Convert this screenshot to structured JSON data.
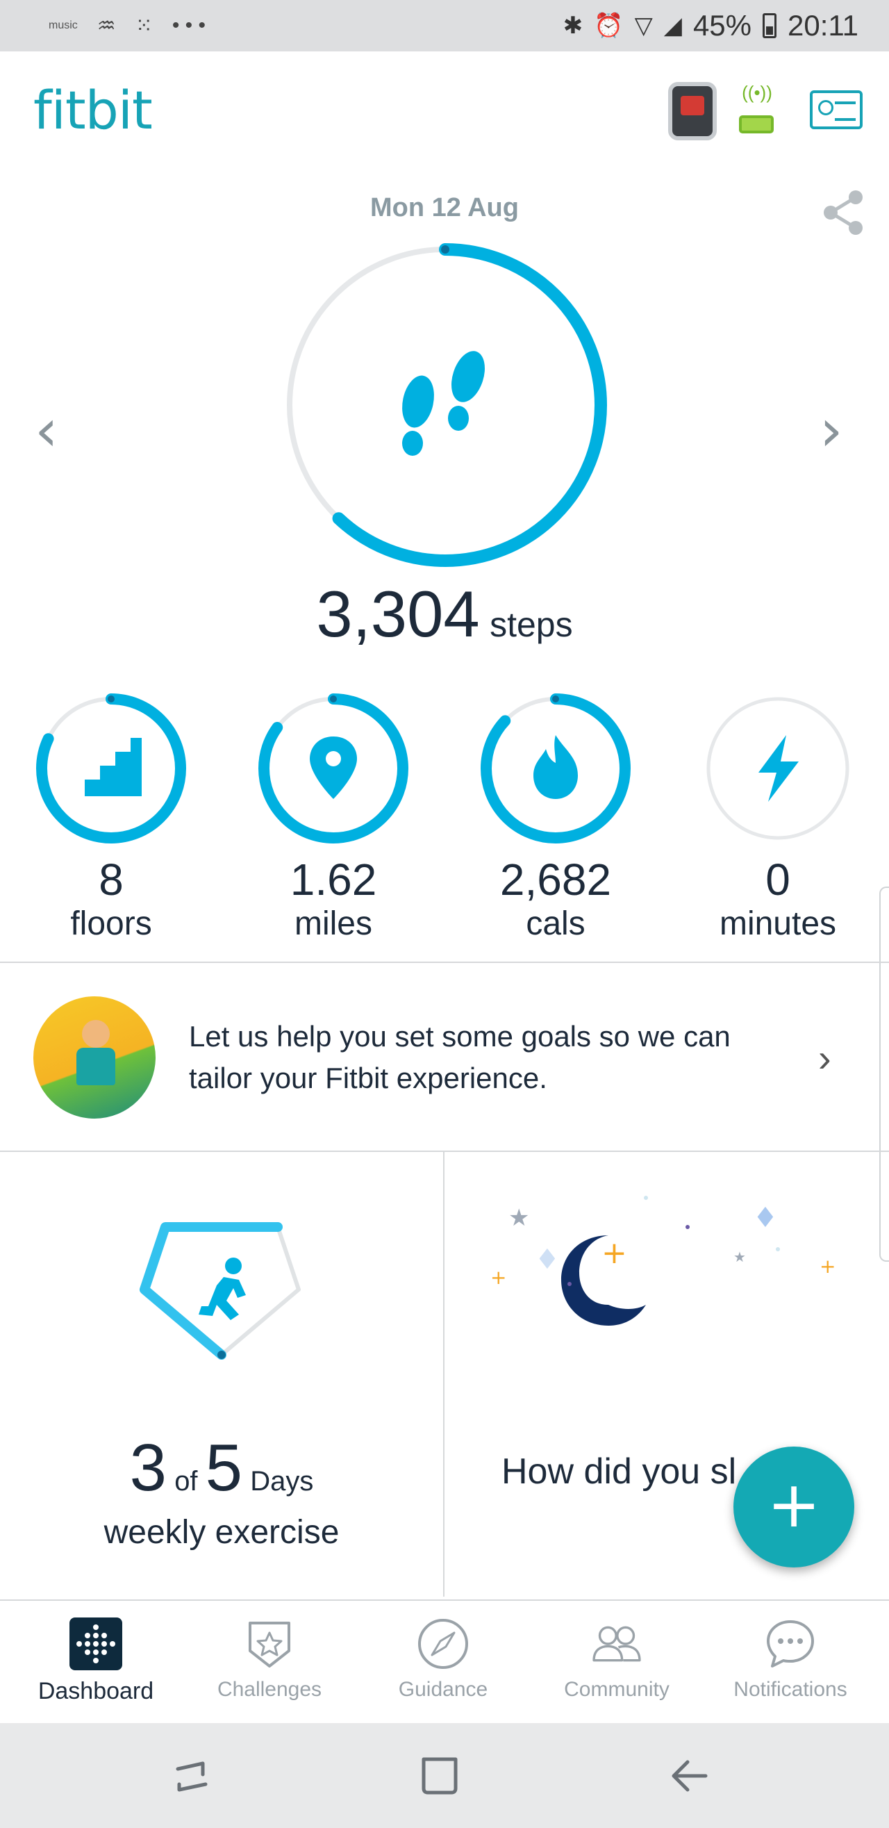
{
  "status_bar": {
    "left_icons": [
      "music",
      "amazon-icon",
      "fitbit-dots-icon",
      "more-icon"
    ],
    "music_label": "music",
    "more": "• • •",
    "battery": "45%",
    "time": "20:11"
  },
  "header": {
    "logo": "fitbit"
  },
  "dashboard": {
    "date": "Mon 12 Aug",
    "steps": {
      "value": "3,304",
      "unit": "steps",
      "progress": 0.62
    },
    "stats": [
      {
        "value": "8",
        "unit": "floors",
        "icon": "stairs-icon",
        "progress": 0.82
      },
      {
        "value": "1.62",
        "unit": "miles",
        "icon": "location-pin-icon",
        "progress": 0.85
      },
      {
        "value": "2,682",
        "unit": "cals",
        "icon": "flame-icon",
        "progress": 0.87
      },
      {
        "value": "0",
        "unit": "minutes",
        "icon": "lightning-icon",
        "progress": 0
      }
    ]
  },
  "goal_banner": {
    "text": "Let us help you set some goals so we can tailor your Fitbit experience."
  },
  "tiles": {
    "exercise": {
      "count": "3",
      "of": "of",
      "total": "5",
      "days": "Days",
      "label": "weekly exercise",
      "progress": 0.6
    },
    "sleep": {
      "prompt": "How did you sl"
    }
  },
  "fab": {
    "label": "+"
  },
  "bottom_nav": [
    {
      "label": "Dashboard",
      "icon": "dashboard-icon",
      "active": true
    },
    {
      "label": "Challenges",
      "icon": "challenges-icon",
      "active": false
    },
    {
      "label": "Guidance",
      "icon": "compass-icon",
      "active": false
    },
    {
      "label": "Community",
      "icon": "community-icon",
      "active": false
    },
    {
      "label": "Notifications",
      "icon": "chat-icon",
      "active": false
    }
  ],
  "colors": {
    "accent": "#00b0e0",
    "teal": "#17a3b6",
    "track": "#e6e8ea",
    "text": "#1d2a3a"
  }
}
